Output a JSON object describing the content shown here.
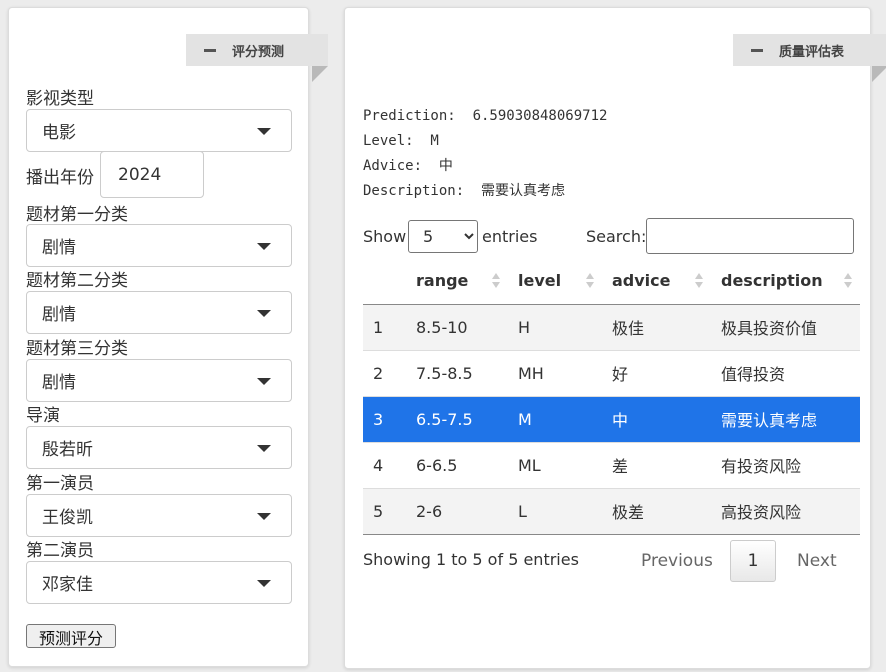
{
  "left_panel": {
    "title": "评分预测",
    "fields": {
      "genre_type": {
        "label": "影视类型",
        "value": "电影"
      },
      "year": {
        "label": "播出年份",
        "value": "2024"
      },
      "topic1": {
        "label": "题材第一分类",
        "value": "剧情"
      },
      "topic2": {
        "label": "题材第二分类",
        "value": "剧情"
      },
      "topic3": {
        "label": "题材第三分类",
        "value": "剧情"
      },
      "director": {
        "label": "导演",
        "value": "殷若昕"
      },
      "actor1": {
        "label": "第一演员",
        "value": "王俊凯"
      },
      "actor2": {
        "label": "第二演员",
        "value": "邓家佳"
      }
    },
    "predict_button": "预测评分"
  },
  "right_panel": {
    "title": "质量评估表",
    "prediction": {
      "prediction": "Prediction:  6.59030848069712",
      "level": "Level:  M",
      "advice": "Advice:  中",
      "description": "Description:  需要认真考虑"
    },
    "controls": {
      "show_label": "Show",
      "entries_value": "5",
      "entries_label": "entries",
      "search_label": "Search:",
      "search_value": ""
    },
    "table": {
      "columns": [
        "range",
        "level",
        "advice",
        "description"
      ],
      "rows": [
        {
          "id": "1",
          "range": "8.5-10",
          "level": "H",
          "advice": "极佳",
          "description": "极具投资价值"
        },
        {
          "id": "2",
          "range": "7.5-8.5",
          "level": "MH",
          "advice": "好",
          "description": "值得投资"
        },
        {
          "id": "3",
          "range": "6.5-7.5",
          "level": "M",
          "advice": "中",
          "description": "需要认真考虑"
        },
        {
          "id": "4",
          "range": "6-6.5",
          "level": "ML",
          "advice": "差",
          "description": "有投资风险"
        },
        {
          "id": "5",
          "range": "2-6",
          "level": "L",
          "advice": "极差",
          "description": "高投资风险"
        }
      ]
    },
    "info": "Showing 1 to 5 of 5 entries",
    "pagination": {
      "previous": "Previous",
      "page": "1",
      "next": "Next"
    }
  },
  "colors": {
    "selected_row": "#1f74e8",
    "ribbon": "#e3e3e3"
  }
}
